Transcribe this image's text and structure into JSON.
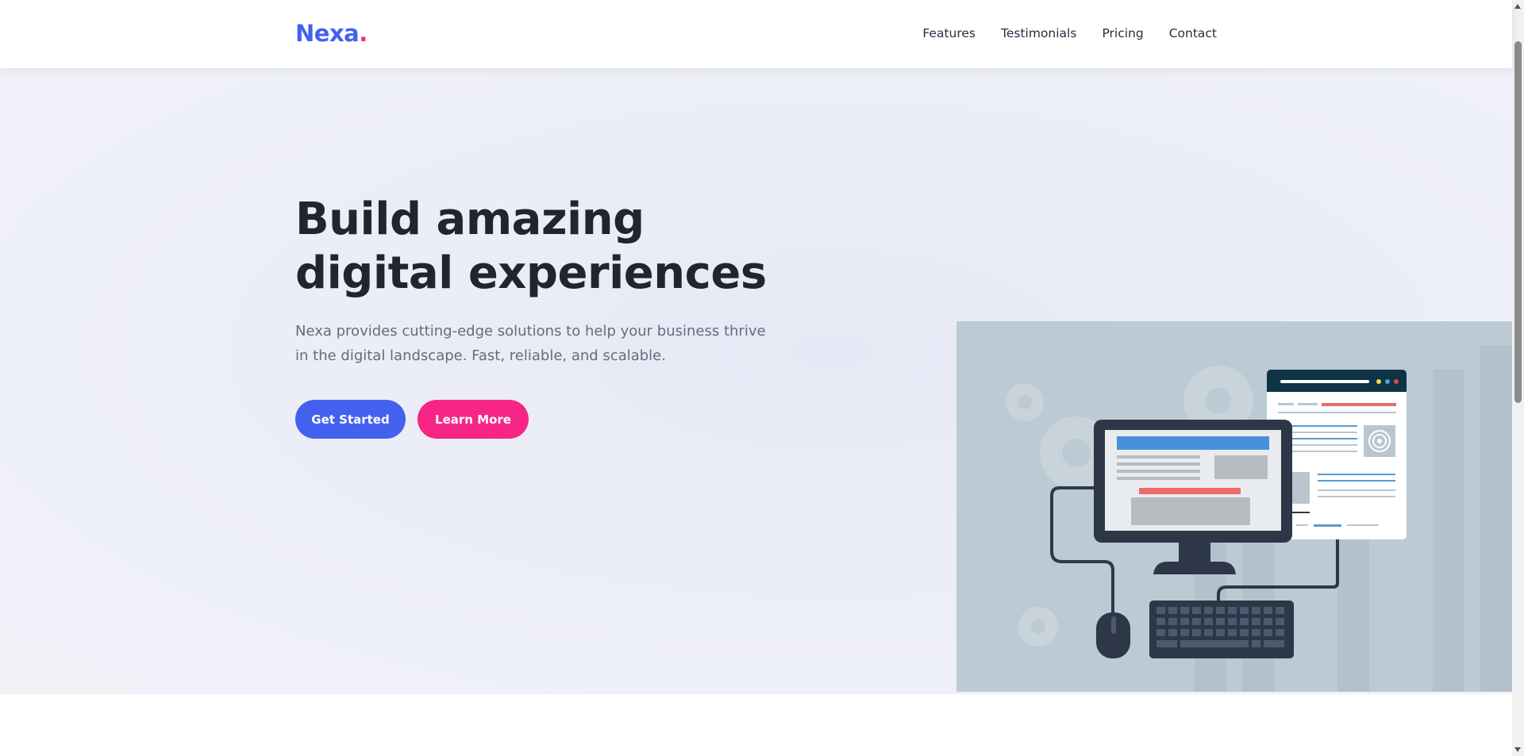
{
  "brand": {
    "name": "Nexa",
    "dot": ".",
    "color": "#4361ee",
    "accent": "#f72585"
  },
  "nav": {
    "links": [
      {
        "label": "Features"
      },
      {
        "label": "Testimonials"
      },
      {
        "label": "Pricing"
      },
      {
        "label": "Contact"
      }
    ]
  },
  "hero": {
    "title": "Build amazing digital experiences",
    "subtitle": "Nexa provides cutting-edge solutions to help your business thrive in the digital landscape. Fast, reliable, and scalable.",
    "primary_button": "Get Started",
    "secondary_button": "Learn More",
    "illustration": "desktop-computer-illustration"
  },
  "colors": {
    "primary": "#4361ee",
    "secondary": "#f72585",
    "text_dark": "#22252f",
    "text_muted": "#676b7b",
    "illustration_bg": "#bccad4"
  }
}
